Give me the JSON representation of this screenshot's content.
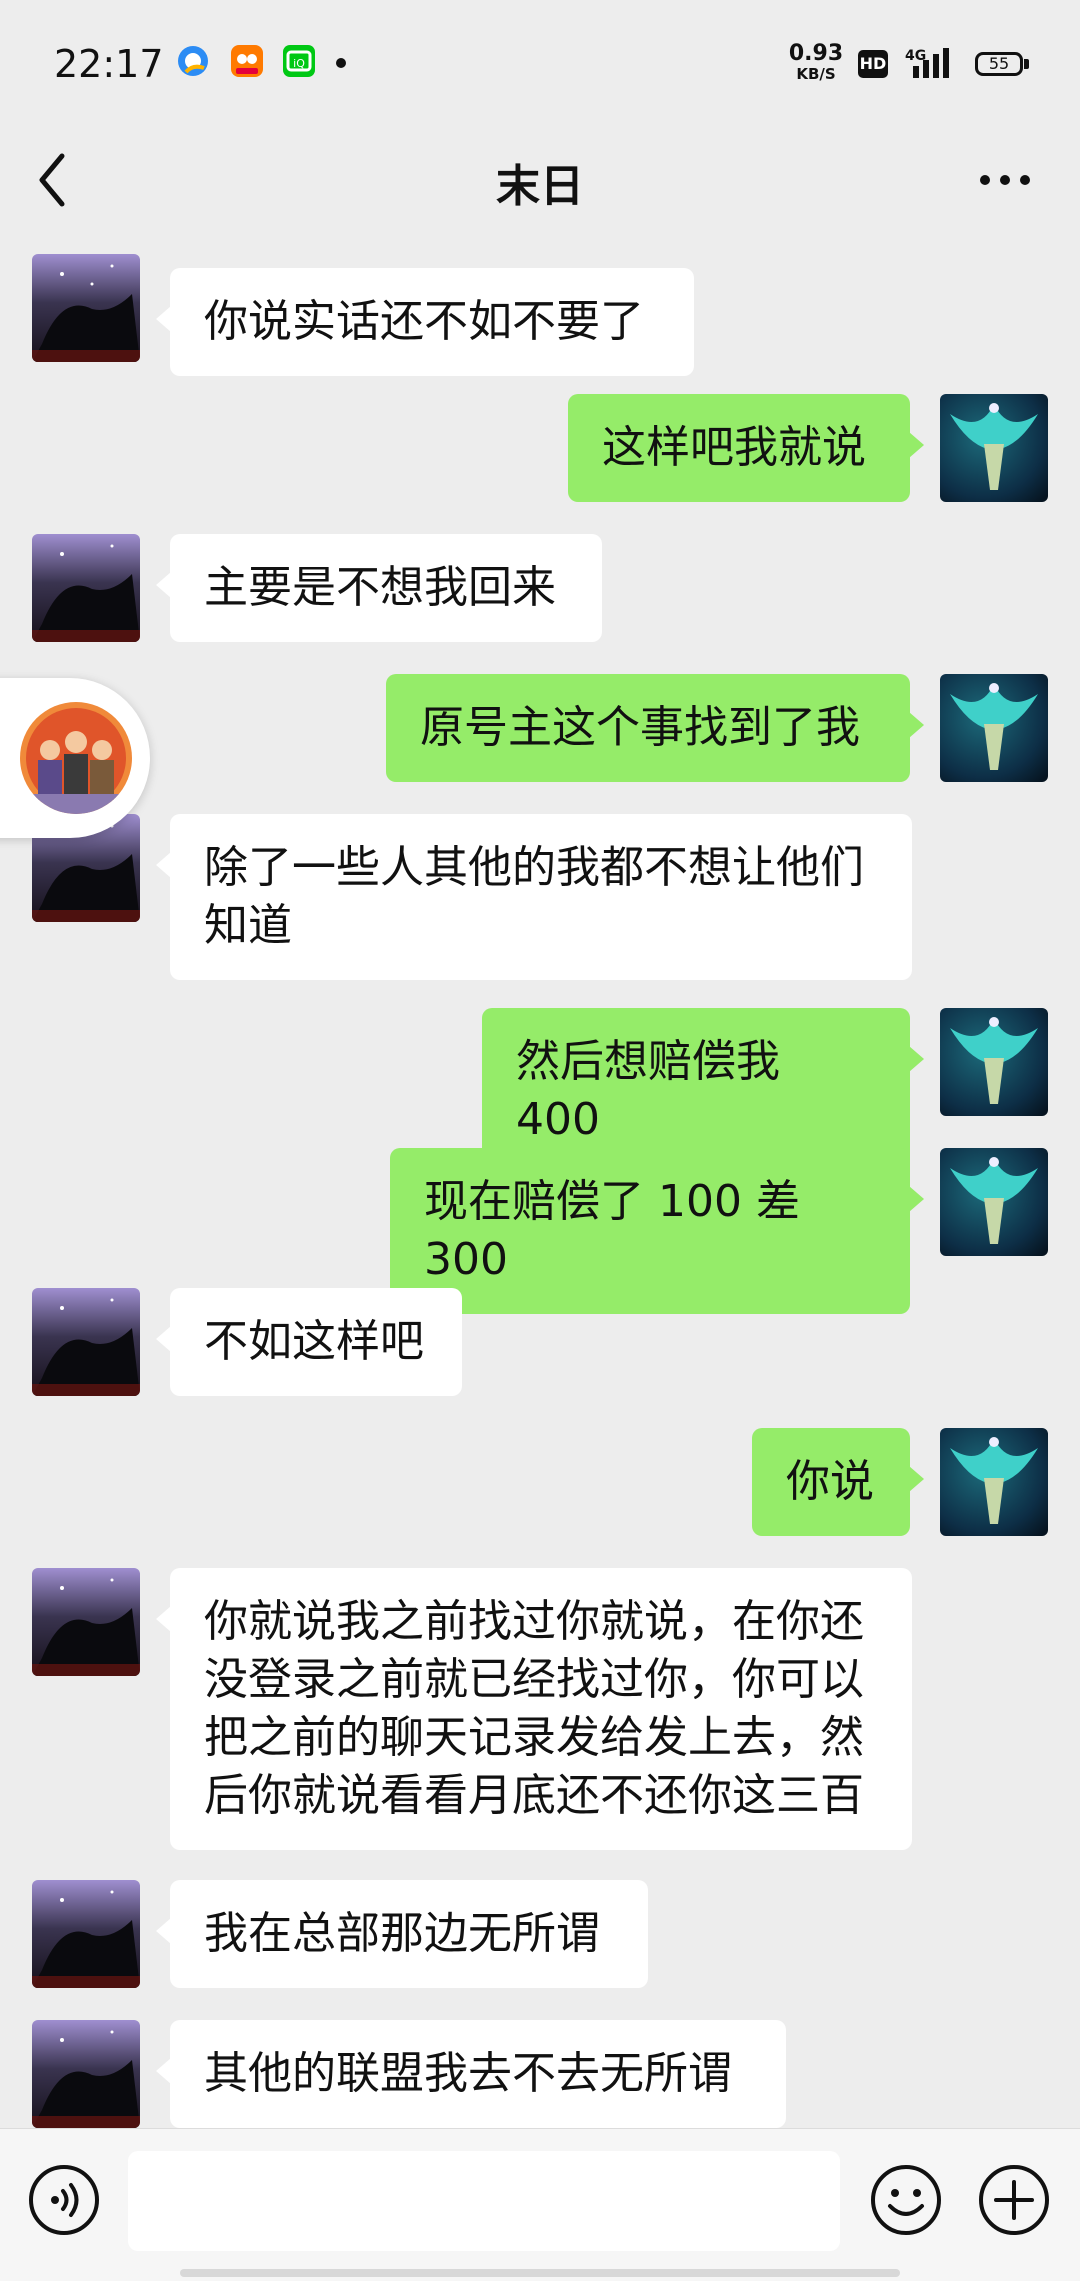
{
  "status_bar": {
    "time": "22:17",
    "net_speed_value": "0.93",
    "net_speed_unit": "KB/S",
    "hd_label": "HD",
    "network_label": "4G",
    "battery": "55",
    "icons": [
      "qq-browser-icon",
      "bilibili-icon",
      "iqiyi-icon",
      "notification-dot-icon",
      "hd-icon",
      "signal-icon",
      "battery-icon"
    ]
  },
  "header": {
    "title": "末日",
    "back_icon": "chevron-left-icon",
    "more_icon": "more-dots-icon"
  },
  "messages": [
    {
      "side": "left",
      "text": "你说实话还不如不要了"
    },
    {
      "side": "right",
      "text": "这样吧我就说"
    },
    {
      "side": "left",
      "text": "主要是不想我回来"
    },
    {
      "side": "right",
      "text": "原号主这个事找到了我"
    },
    {
      "side": "left",
      "text": "除了一些人其他的我都不想让他们知道"
    },
    {
      "side": "right",
      "text": "然后想赔偿我 400"
    },
    {
      "side": "right",
      "text": "现在赔偿了 100 差 300"
    },
    {
      "side": "left",
      "text": "不如这样吧"
    },
    {
      "side": "right",
      "text": "你说"
    },
    {
      "side": "left",
      "text": "你就说我之前找过你就说，在你还没登录之前就已经找过你，你可以把之前的聊天记录发给发上去，然后你就说看看月底还不还你这三百"
    },
    {
      "side": "left",
      "text": "我在总部那边无所谓"
    },
    {
      "side": "left",
      "text": "其他的联盟我去不去无所谓"
    }
  ],
  "input_bar": {
    "voice_icon": "voice-icon",
    "emoji_icon": "emoji-icon",
    "add_icon": "plus-circle-icon"
  },
  "colors": {
    "background": "#ededed",
    "sent_bubble": "#95ec69",
    "received_bubble": "#ffffff"
  }
}
